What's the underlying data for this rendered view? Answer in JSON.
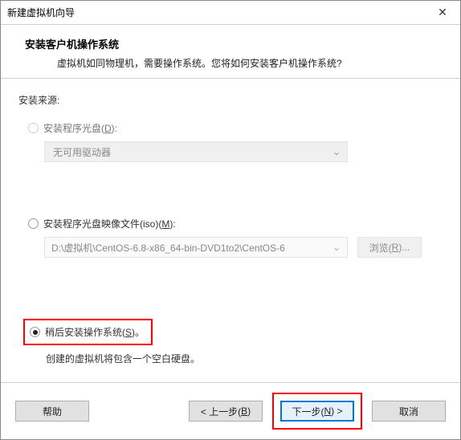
{
  "window": {
    "title": "新建虚拟机向导",
    "close_glyph": "✕"
  },
  "header": {
    "title": "安装客户机操作系统",
    "subtitle": "虚拟机如同物理机，需要操作系统。您将如何安装客户机操作系统?"
  },
  "body": {
    "source_label": "安装来源:",
    "opt_disc": {
      "label_pre": "安装程序光盘(",
      "mn": "D",
      "label_post": "):"
    },
    "dropdown_text": "无可用驱动器",
    "opt_iso": {
      "label_pre": "安装程序光盘映像文件(iso)(",
      "mn": "M",
      "label_post": "):"
    },
    "iso_path": "D:\\虚拟机\\CentOS-6.8-x86_64-bin-DVD1to2\\CentOS-6",
    "browse": {
      "pre": "浏览(",
      "mn": "R",
      "post": ")..."
    },
    "opt_later": {
      "label_pre": "稍后安装操作系统(",
      "mn": "S",
      "label_post": ")。"
    },
    "hint": "创建的虚拟机将包含一个空白硬盘。"
  },
  "footer": {
    "help": "帮助",
    "back": {
      "pre": "< 上一步(",
      "mn": "B",
      "post": ")"
    },
    "next": {
      "pre": "下一步(",
      "mn": "N",
      "post": ") >"
    },
    "cancel": "取消"
  },
  "glyphs": {
    "chev": "⌄"
  }
}
